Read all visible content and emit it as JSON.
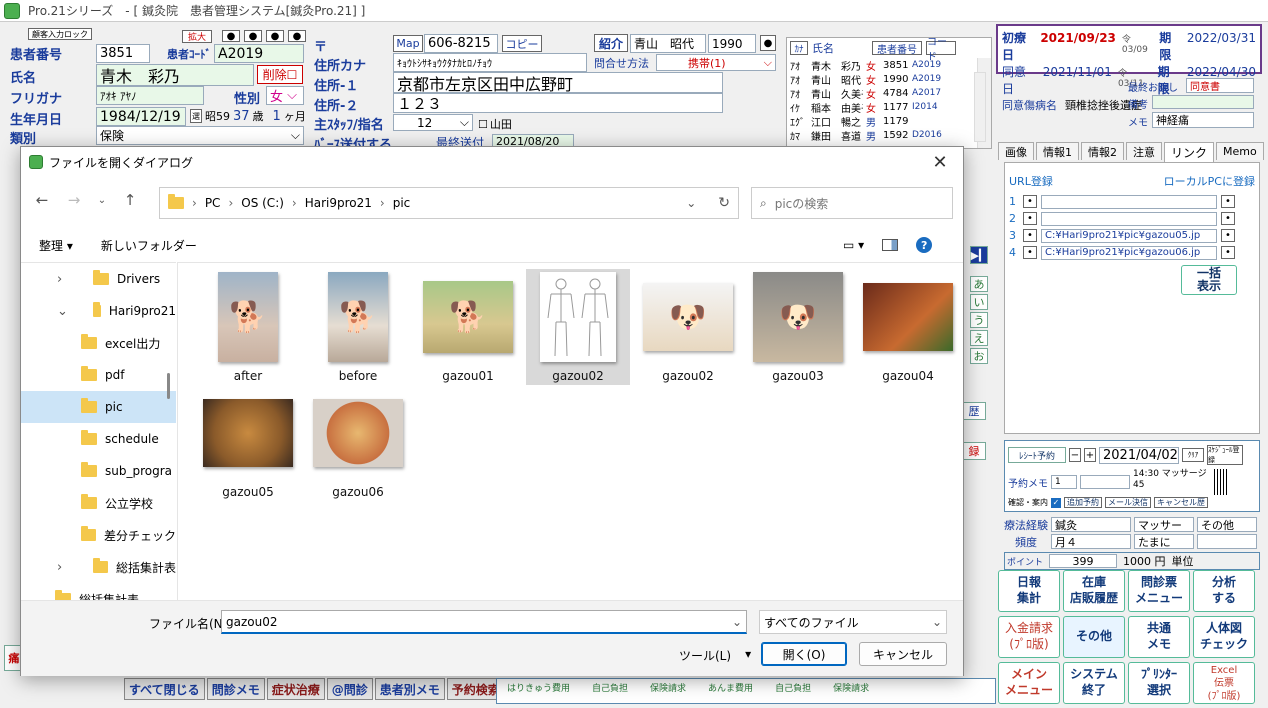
{
  "app": {
    "title": "Pro.21シリーズ　- [ 鍼灸院　患者管理システム[鍼灸Pro.21] ]"
  },
  "patient": {
    "id_label": "患者番号",
    "id_value": "3851",
    "code_label": "患者ｺｰﾄﾞ",
    "code_value": "A2019",
    "name_label": "氏名",
    "name_value": "青木　彩乃",
    "delete_label": "削除",
    "kana_label": "フリガナ",
    "kana_value": "ｱｵｷ ｱﾔﾉ",
    "sex_label": "性別",
    "sex_value": "女",
    "birth_label": "生年月日",
    "birth_value": "1984/12/19",
    "era_value": "昭59",
    "age_value": "37",
    "age_unit": "歳",
    "month_value": "1",
    "month_unit": "ヶ月",
    "type_label": "類別",
    "type_value": "保険",
    "lock_label": "顧客入力ロック",
    "expand_label": "拡大",
    "postal_label": "〒",
    "map_label": "Map",
    "postal_value": "606-8215",
    "copy_label": "コピー",
    "address_kana_label": "住所カナ",
    "address_kana_value": "ｷｮｳﾄｼｻｷｮｳｸﾀﾅｶﾋﾛﾉﾁｮｳ",
    "address1_label": "住所-１",
    "address1_value": "京都市左京区田中広野町",
    "address2_label": "住所-２",
    "address2_value": "１２３",
    "staff_label": "主ｽﾀｯﾌ/指名",
    "staff_value": "12",
    "staff_check_label": "山田",
    "birthday_send_label": "ﾊﾞｰｽ送付する",
    "last_sent_label": "最終送付",
    "last_sent_value": "2021/08/20",
    "referral_label": "紹介",
    "referral_value": "青山　昭代",
    "referral_num": "1990",
    "contact_label": "問合せ方法",
    "contact_value": "携帯(1)"
  },
  "patient_list": {
    "headers": [
      "ｶﾅ",
      "氏名",
      "患者番号",
      "コード"
    ],
    "rows": [
      {
        "kana": "ｱｵ",
        "name": "青木　彩乃",
        "sex": "女",
        "num": "3851",
        "code": "A2019"
      },
      {
        "kana": "ｱｵ",
        "name": "青山　昭代",
        "sex": "女",
        "num": "1990",
        "code": "A2019"
      },
      {
        "kana": "ｱｵ",
        "name": "青山　久美子",
        "sex": "女",
        "num": "4784",
        "code": "A2017"
      },
      {
        "kana": "ｲｹ",
        "name": "稲本　由美子",
        "sex": "女",
        "num": "1177",
        "code": "I2014"
      },
      {
        "kana": "ｴｸﾞ",
        "name": "江口　暢之",
        "sex": "男",
        "num": "1179",
        "code": ""
      },
      {
        "kana": "ｶﾏ",
        "name": "鎌田　喜道",
        "sex": "男",
        "num": "1592",
        "code": "D2016"
      }
    ]
  },
  "visit_info": {
    "first_label": "初療日",
    "first_value": "2021/09/23",
    "first_era": "令03/09",
    "first_period_label": "期限",
    "first_period_value": "2022/03/31",
    "consent_label": "同意日",
    "consent_value": "2021/11/01",
    "consent_era": "令03/11",
    "consent_period_label": "期限",
    "consent_period_value": "2022/04/30",
    "disease_label": "同意傷病名",
    "disease_value": "頸椎捻挫後遺症",
    "last_given_label": "最終お渡し",
    "last_given_value": "同意書",
    "memo_label": "備考",
    "memo2_label": "メモ",
    "memo2_value": "神経痛"
  },
  "right_tabs": [
    "画像",
    "情報1",
    "情報2",
    "注意",
    "リンク",
    "Memo"
  ],
  "links": {
    "url_label": "URL登録",
    "local_label": "ローカルPCに登録",
    "rows": [
      {
        "num": "1",
        "value": ""
      },
      {
        "num": "2",
        "value": ""
      },
      {
        "num": "3",
        "value": "C:¥Hari9pro21¥pic¥gazou05.jp"
      },
      {
        "num": "4",
        "value": "C:¥Hari9pro21¥pic¥gazou06.jp"
      }
    ],
    "show_all_label": "一括\n表示"
  },
  "kana_index": [
    "あ",
    "い",
    "う",
    "え",
    "お"
  ],
  "reservation": {
    "receipt_label": "ﾚｼｰﾄ予約",
    "date_value": "2021/04/02",
    "clear_label": "ｸﾘｱ",
    "schedule_label": "ｽｹｼﾞｭｰﾙ登録",
    "memo_label": "予約メモ",
    "memo_num": "1",
    "time_value": "14:30 マッサージ 45",
    "confirm_label": "確認・案内",
    "add_label": "追加予約",
    "mail_label": "メール決信",
    "cancel_label": "キャンセル歴"
  },
  "treatment": {
    "label": "療法経験",
    "values": [
      "鍼灸",
      "マッサー",
      "その他"
    ],
    "freq_label": "頻度",
    "freq_values": [
      "月４",
      "たまに",
      ""
    ],
    "point_label": "ポイント",
    "point_value": "399",
    "point_yen": "1000 円",
    "point_unit": "単位"
  },
  "right_buttons": [
    "日報\n集計",
    "在庫\n店販履歴",
    "問診票\nメニュー",
    "分析\nする",
    "入金請求\n(ﾌﾟﾛ版)",
    "その他",
    "共通\nメモ",
    "人体図\nチェック",
    "メイン\nメニュー",
    "システム\n終了",
    "ﾌﾟﾘﾝﾀｰ\n選択",
    "Excel\n伝票\n(ﾌﾟﾛ版)"
  ],
  "bottom_buttons": [
    "すべて閉じる",
    "問診メモ",
    "症状治療",
    "@問診",
    "患者別メモ",
    "予約検索"
  ],
  "bottom_fees": [
    "はりきゅう費用",
    "自己負担",
    "保険請求",
    "あんま費用",
    "自己負担",
    "保険請求"
  ],
  "dialog": {
    "title": "ファイルを開くダイアログ",
    "breadcrumb": [
      "PC",
      "OS (C:)",
      "Hari9pro21",
      "pic"
    ],
    "search_placeholder": "picの検索",
    "organize_label": "整理",
    "new_folder_label": "新しいフォルダー",
    "tree": [
      "Drivers",
      "Hari9pro21",
      "excel出力",
      "pdf",
      "pic",
      "schedule",
      "sub_progra",
      "公立学校",
      "差分チェック",
      "総括集計表",
      "総括集計表"
    ],
    "files": [
      "after",
      "before",
      "gazou01",
      "gazou02",
      "gazou02",
      "gazou03",
      "gazou04",
      "gazou05",
      "gazou06"
    ],
    "filename_label": "ファイル名(N):",
    "filename_value": "gazou02",
    "filetype_value": "すべてのファイル",
    "tools_label": "ツール(L)",
    "open_label": "開く(O)",
    "cancel_label": "キャンセル"
  },
  "colors": {
    "accent_blue": "#1a3c9c",
    "selected_bg": "#cce4f7",
    "right_border": "#2a8a4a",
    "dialog_btn_border": "#0067c0"
  }
}
